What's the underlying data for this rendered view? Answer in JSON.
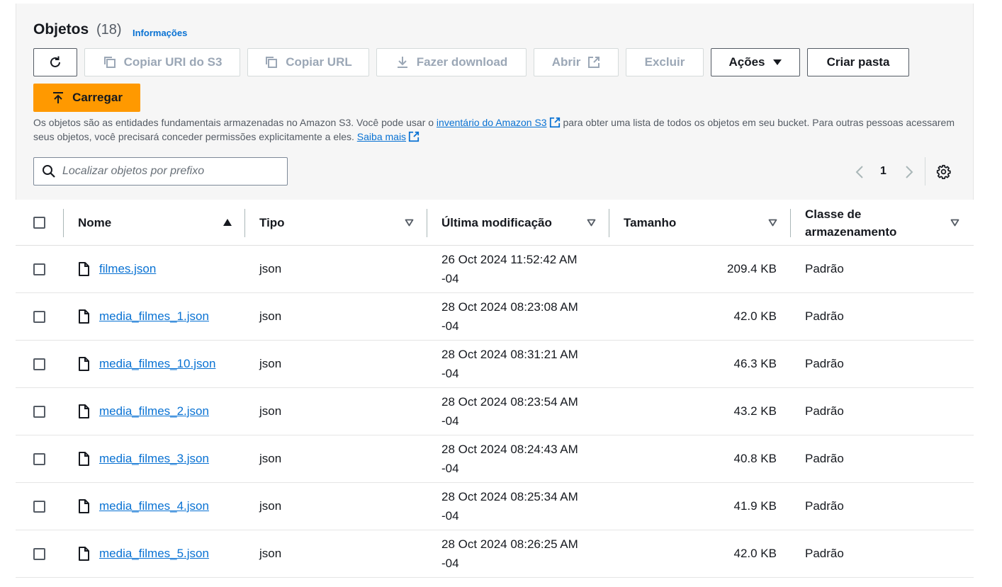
{
  "header": {
    "title": "Objetos",
    "count": "(18)",
    "info_link": "Informações"
  },
  "toolbar": {
    "copy_uri": "Copiar URI do S3",
    "copy_url": "Copiar URL",
    "download": "Fazer download",
    "open": "Abrir",
    "delete": "Excluir",
    "actions": "Ações",
    "create_folder": "Criar pasta",
    "upload": "Carregar"
  },
  "description": {
    "part1": "Os objetos são as entidades fundamentais armazenadas no Amazon S3. Você pode usar o ",
    "link1": "inventário do Amazon S3",
    "part2": " para obter uma lista de todos os objetos em seu bucket. Para outras pessoas acessarem seus objetos, você precisará conceder permissões explicitamente a eles. ",
    "link2": "Saiba mais"
  },
  "search": {
    "placeholder": "Localizar objetos por prefixo"
  },
  "pagination": {
    "current_page": "1"
  },
  "table": {
    "columns": {
      "name": "Nome",
      "type": "Tipo",
      "modified": "Última modificação",
      "size": "Tamanho",
      "storage_class_line1": "Classe de",
      "storage_class_line2": "armazenamento"
    },
    "rows": [
      {
        "name": "filmes.json",
        "type": "json",
        "date": "26 Oct 2024 11:52:42 AM",
        "tz": "-04",
        "size": "209.4 KB",
        "storage": "Padrão"
      },
      {
        "name": "media_filmes_1.json",
        "type": "json",
        "date": "28 Oct 2024 08:23:08 AM",
        "tz": "-04",
        "size": "42.0 KB",
        "storage": "Padrão"
      },
      {
        "name": "media_filmes_10.json",
        "type": "json",
        "date": "28 Oct 2024 08:31:21 AM",
        "tz": "-04",
        "size": "46.3 KB",
        "storage": "Padrão"
      },
      {
        "name": "media_filmes_2.json",
        "type": "json",
        "date": "28 Oct 2024 08:23:54 AM",
        "tz": "-04",
        "size": "43.2 KB",
        "storage": "Padrão"
      },
      {
        "name": "media_filmes_3.json",
        "type": "json",
        "date": "28 Oct 2024 08:24:43 AM",
        "tz": "-04",
        "size": "40.8 KB",
        "storage": "Padrão"
      },
      {
        "name": "media_filmes_4.json",
        "type": "json",
        "date": "28 Oct 2024 08:25:34 AM",
        "tz": "-04",
        "size": "41.9 KB",
        "storage": "Padrão"
      },
      {
        "name": "media_filmes_5.json",
        "type": "json",
        "date": "28 Oct 2024 08:26:25 AM",
        "tz": "-04",
        "size": "42.0 KB",
        "storage": "Padrão"
      }
    ]
  },
  "colors": {
    "accent": "#0972d3",
    "primary_button": "#ff9900",
    "disabled_text": "#9ba7b6",
    "panel_bg": "#f6f6f6"
  }
}
